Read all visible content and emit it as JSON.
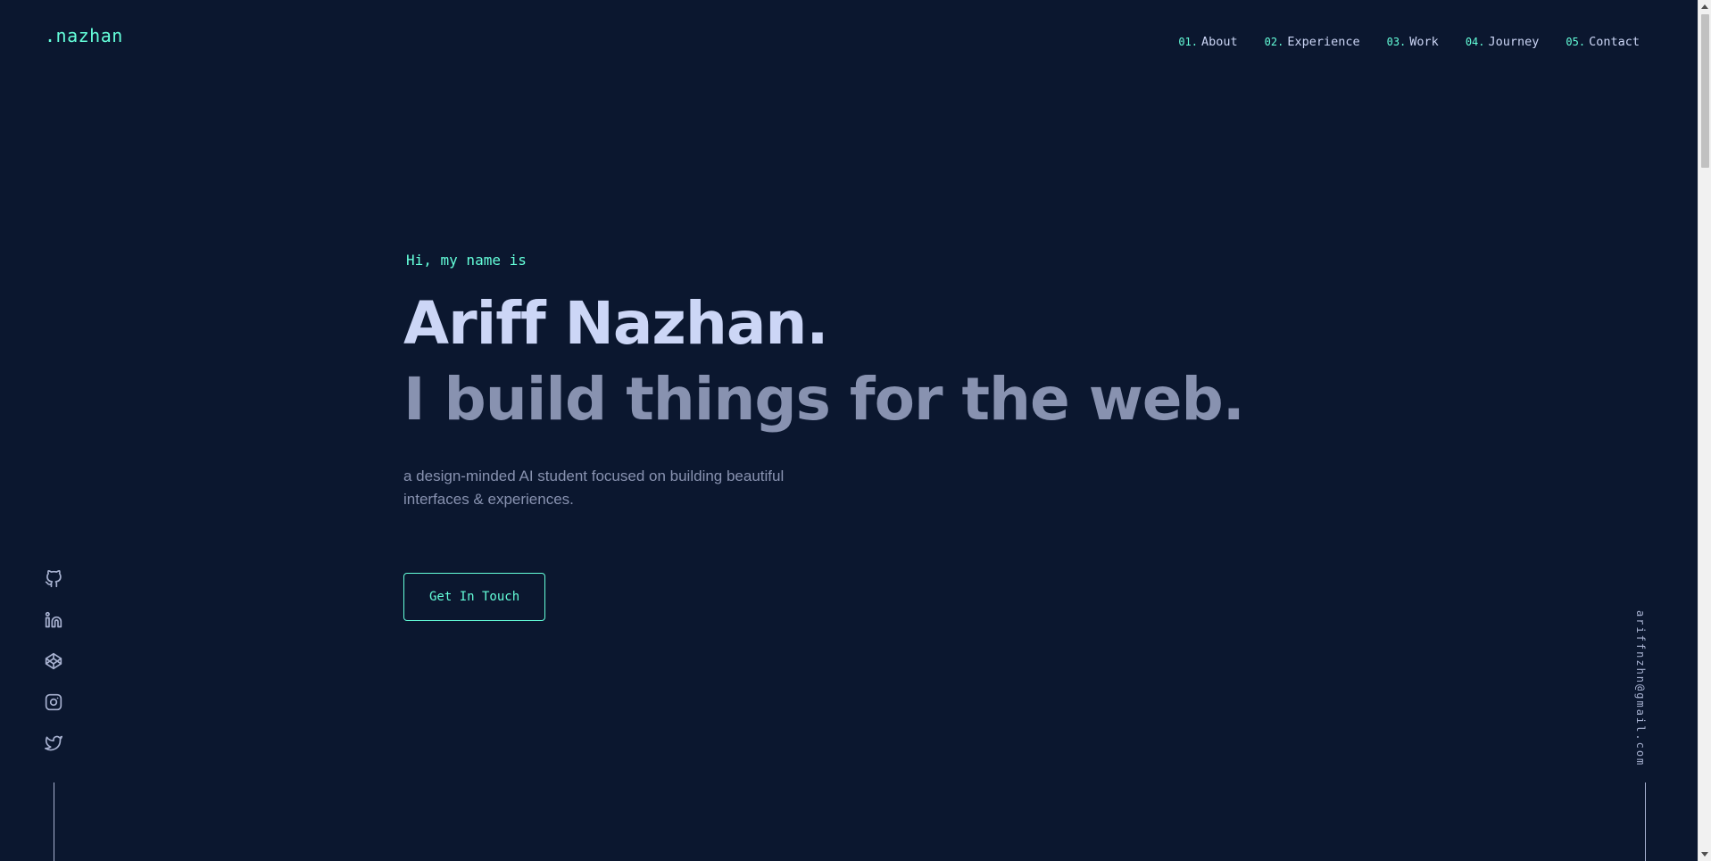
{
  "brand": {
    "logo": ".nazhan"
  },
  "nav": {
    "items": [
      {
        "num": "01.",
        "label": "About"
      },
      {
        "num": "02.",
        "label": "Experience"
      },
      {
        "num": "03.",
        "label": "Work"
      },
      {
        "num": "04.",
        "label": "Journey"
      },
      {
        "num": "05.",
        "label": "Contact"
      }
    ]
  },
  "hero": {
    "greeting": "Hi, my name is",
    "name": "Ariff Nazhan.",
    "tagline": "I build things for the web.",
    "description": "a design-minded AI student focused on building beautiful interfaces & experiences.",
    "cta_label": "Get In Touch"
  },
  "socials": [
    "github-icon",
    "linkedin-icon",
    "codepen-icon",
    "instagram-icon",
    "twitter-icon"
  ],
  "contact": {
    "email": "ariffnzhn@gmail.com"
  },
  "colors": {
    "background": "#0b172f",
    "accent": "#64ffda",
    "heading": "#ccd6f6",
    "muted": "#8892b0"
  }
}
